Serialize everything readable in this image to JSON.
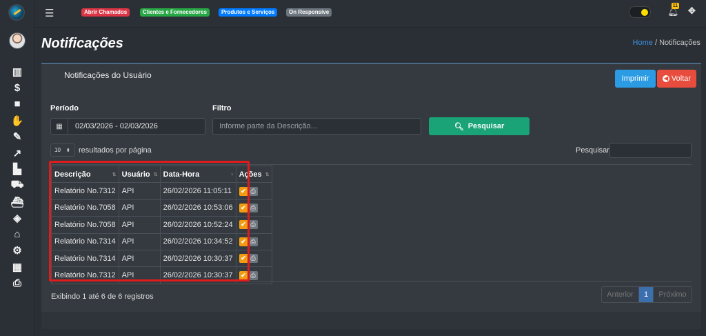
{
  "topbar": {
    "badges": [
      "Abrir Chamados",
      "Clientes e Fornecedores",
      "Produtos e Serviços",
      "On Responsive"
    ],
    "notification_count": "11"
  },
  "sidebar": {
    "icons": [
      "barcode-icon",
      "dollar-icon",
      "briefcase-icon",
      "handshake-icon",
      "edit-icon",
      "chart-line-icon",
      "industry-icon",
      "cart-icon",
      "ship-icon",
      "cube-icon",
      "bank-icon",
      "cogs-icon",
      "table-icon",
      "print-icon"
    ]
  },
  "page": {
    "title": "Notificações",
    "breadcrumb_home": "Home",
    "breadcrumb_sep": "/",
    "breadcrumb_current": "Notificações"
  },
  "card": {
    "title": "Notificações do Usuário",
    "print_label": "Imprimir",
    "back_label": "Voltar"
  },
  "filters": {
    "period_label": "Período",
    "period_value": "02/03/2026 - 02/03/2026",
    "filter_label": "Filtro",
    "filter_placeholder": "Informe parte da Descrição...",
    "search_button": "Pesquisar"
  },
  "table_controls": {
    "page_length": "10",
    "page_length_suffix": "resultados por página",
    "search_label": "Pesquisar"
  },
  "table": {
    "headers": [
      "Descrição",
      "Usuário",
      "Data-Hora",
      "Ações"
    ],
    "rows": [
      {
        "desc": "Relatório No.7312",
        "user": "API",
        "datetime": "26/02/2026 11:05:11"
      },
      {
        "desc": "Relatório No.7058",
        "user": "API",
        "datetime": "26/02/2026 10:53:06"
      },
      {
        "desc": "Relatório No.7058",
        "user": "API",
        "datetime": "26/02/2026 10:52:24"
      },
      {
        "desc": "Relatório No.7314",
        "user": "API",
        "datetime": "26/02/2026 10:34:52"
      },
      {
        "desc": "Relatório No.7314",
        "user": "API",
        "datetime": "26/02/2026 10:30:37"
      },
      {
        "desc": "Relatório No.7312",
        "user": "API",
        "datetime": "26/02/2026 10:30:37"
      }
    ]
  },
  "footer": {
    "info": "Exibindo 1 até 6 de 6 registros",
    "prev": "Anterior",
    "page": "1",
    "next": "Próximo"
  },
  "colors": {
    "highlight_box": "#e01b1b",
    "accent_green": "#1aa377",
    "accent_blue": "#2b9be4",
    "accent_red": "#e74c3c"
  }
}
